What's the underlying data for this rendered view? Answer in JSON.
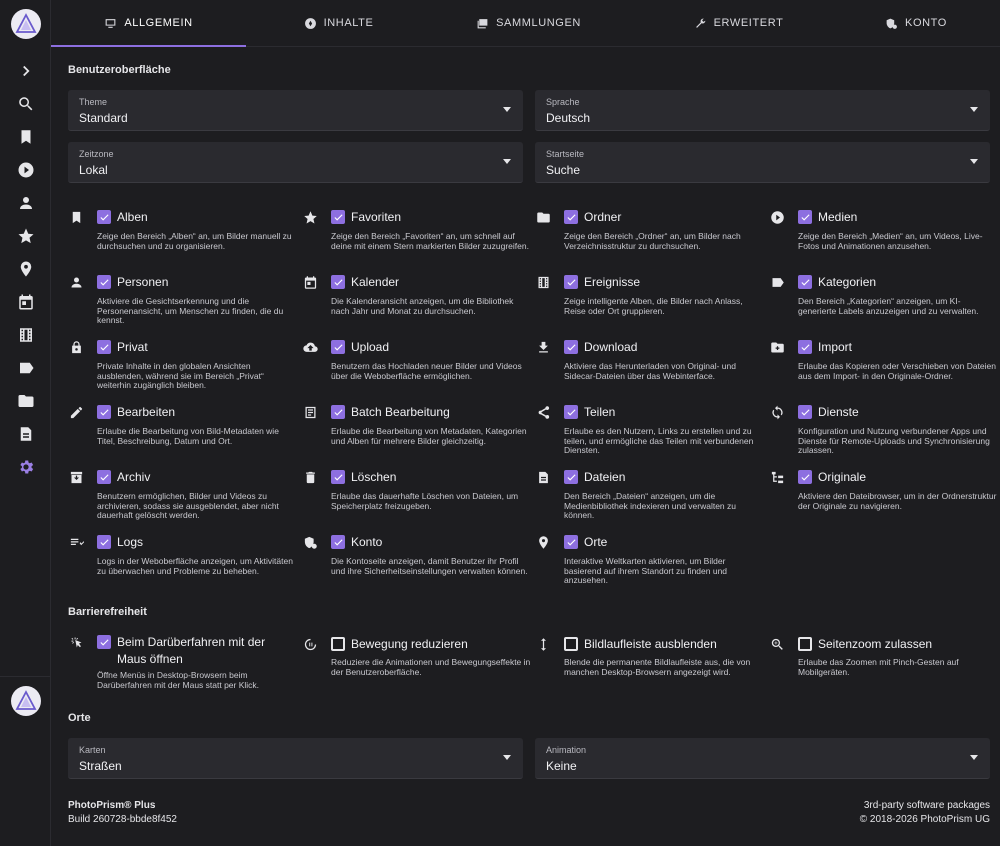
{
  "tabs": [
    {
      "label": "ALLGEMEIN",
      "icon": "monitor-icon",
      "active": true
    },
    {
      "label": "INHALTE",
      "icon": "aperture-icon"
    },
    {
      "label": "SAMMLUNGEN",
      "icon": "collections-icon"
    },
    {
      "label": "ERWEITERT",
      "icon": "wrench-icon"
    },
    {
      "label": "KONTO",
      "icon": "account-shield-icon"
    }
  ],
  "sections": {
    "ui": "Benutzeroberfläche",
    "accessibility": "Barrierefreiheit",
    "places": "Orte"
  },
  "selects": {
    "theme": {
      "label": "Theme",
      "value": "Standard"
    },
    "language": {
      "label": "Sprache",
      "value": "Deutsch"
    },
    "timezone": {
      "label": "Zeitzone",
      "value": "Lokal"
    },
    "startpage": {
      "label": "Startseite",
      "value": "Suche"
    },
    "maps": {
      "label": "Karten",
      "value": "Straßen"
    },
    "animation": {
      "label": "Animation",
      "value": "Keine"
    }
  },
  "options": [
    {
      "title": "Alben",
      "desc": "Zeige den Bereich „Alben“ an, um Bilder manuell zu durchsuchen und zu organisieren.",
      "checked": true,
      "icon": "bookmark-icon"
    },
    {
      "title": "Favoriten",
      "desc": "Zeige den Bereich „Favoriten“ an, um schnell auf deine mit einem Stern markierten Bilder zuzugreifen.",
      "checked": true,
      "icon": "star-icon"
    },
    {
      "title": "Ordner",
      "desc": "Zeige den Bereich „Ordner“ an, um Bilder nach Verzeichnisstruktur zu durchsuchen.",
      "checked": true,
      "icon": "folder-icon"
    },
    {
      "title": "Medien",
      "desc": "Zeige den Bereich „Medien“ an, um Videos, Live-Fotos und Animationen anzusehen.",
      "checked": true,
      "icon": "play-circle-icon"
    },
    {
      "title": "Personen",
      "desc": "Aktiviere die Gesichtserkennung und die Personenansicht, um Menschen zu finden, die du kennst.",
      "checked": true,
      "icon": "person-icon"
    },
    {
      "title": "Kalender",
      "desc": "Die Kalenderansicht anzeigen, um die Bibliothek nach Jahr und Monat zu durchsuchen.",
      "checked": true,
      "icon": "calendar-icon"
    },
    {
      "title": "Ereignisse",
      "desc": "Zeige intelligente Alben, die Bilder nach Anlass, Reise oder Ort gruppieren.",
      "checked": true,
      "icon": "film-icon"
    },
    {
      "title": "Kategorien",
      "desc": "Den Bereich „Kategorien“ anzeigen, um KI-generierte Labels anzuzeigen und zu verwalten.",
      "checked": true,
      "icon": "label-icon"
    },
    {
      "title": "Privat",
      "desc": "Private Inhalte in den globalen Ansichten ausblenden, während sie im Bereich „Privat“ weiterhin zugänglich bleiben.",
      "checked": true,
      "icon": "lock-icon"
    },
    {
      "title": "Upload",
      "desc": "Benutzern das Hochladen neuer Bilder und Videos über die Weboberfläche ermöglichen.",
      "checked": true,
      "icon": "cloud-upload-icon"
    },
    {
      "title": "Download",
      "desc": "Aktiviere das Herunterladen von Original- und Sidecar-Dateien über das Webinterface.",
      "checked": true,
      "icon": "download-icon"
    },
    {
      "title": "Import",
      "desc": "Erlaube das Kopieren oder Verschieben von Dateien aus dem Import- in den Originale-Ordner.",
      "checked": true,
      "icon": "folder-plus-icon"
    },
    {
      "title": "Bearbeiten",
      "desc": "Erlaube die Bearbeitung von Bild-Metadaten wie Titel, Beschreibung, Datum und Ort.",
      "checked": true,
      "icon": "pencil-icon"
    },
    {
      "title": "Batch Bearbeitung",
      "desc": "Erlaube die Bearbeitung von Metadaten, Kategorien und Alben für mehrere Bilder gleichzeitig.",
      "checked": true,
      "icon": "batch-list-icon"
    },
    {
      "title": "Teilen",
      "desc": "Erlaube es den Nutzern, Links zu erstellen und zu teilen, und ermögliche das Teilen mit verbundenen Diensten.",
      "checked": true,
      "icon": "share-icon"
    },
    {
      "title": "Dienste",
      "desc": "Konfiguration und Nutzung verbundener Apps und Dienste für Remote-Uploads und Synchronisierung zulassen.",
      "checked": true,
      "icon": "sync-icon"
    },
    {
      "title": "Archiv",
      "desc": "Benutzern ermöglichen, Bilder und Videos zu archivieren, sodass sie ausgeblendet, aber nicht dauerhaft gelöscht werden.",
      "checked": true,
      "icon": "archive-icon"
    },
    {
      "title": "Löschen",
      "desc": "Erlaube das dauerhafte Löschen von Dateien, um Speicherplatz freizugeben.",
      "checked": true,
      "icon": "trash-icon"
    },
    {
      "title": "Dateien",
      "desc": "Den Bereich „Dateien“ anzeigen, um die Medienbibliothek indexieren und verwalten zu können.",
      "checked": true,
      "icon": "file-cabinet-icon"
    },
    {
      "title": "Originale",
      "desc": "Aktiviere den Dateibrowser, um in der Ordnerstruktur der Originale zu navigieren.",
      "checked": true,
      "icon": "file-tree-icon"
    },
    {
      "title": "Logs",
      "desc": "Logs in der Weboberfläche anzeigen, um Aktivitäten zu überwachen und Probleme zu beheben.",
      "checked": true,
      "icon": "logs-icon"
    },
    {
      "title": "Konto",
      "desc": "Die Kontoseite anzeigen, damit Benutzer ihr Profil und ihre Sicherheitseinstellungen verwalten können.",
      "checked": true,
      "icon": "account-shield-icon"
    },
    {
      "title": "Orte",
      "desc": "Interaktive Weltkarten aktivieren, um Bilder basierend auf ihrem Standort zu finden und anzusehen.",
      "checked": true,
      "icon": "map-marker-icon"
    }
  ],
  "accessibility_options": [
    {
      "title": "Beim Darüberfahren mit der Maus öffnen",
      "desc": "Öffne Menüs in Desktop-Browsern beim Darüberfahren mit der Maus statt per Klick.",
      "checked": true,
      "icon": "cursor-click-icon"
    },
    {
      "title": "Bewegung reduzieren",
      "desc": "Reduziere die Animationen und Bewegungseffekte in der Benutzeroberfläche.",
      "checked": false,
      "icon": "motion-pause-icon"
    },
    {
      "title": "Bildlaufleiste ausblenden",
      "desc": "Blende die permanente Bildlaufleiste aus, die von manchen Desktop-Browsern angezeigt wird.",
      "checked": false,
      "icon": "vertical-arrows-icon"
    },
    {
      "title": "Seitenzoom zulassen",
      "desc": "Erlaube das Zoomen mit Pinch-Gesten auf Mobilgeräten.",
      "checked": false,
      "icon": "zoom-icon"
    }
  ],
  "footer": {
    "brand": "PhotoPrism® Plus",
    "build": "Build 260728-bbde8f452",
    "packages": "3rd-party software packages",
    "copyright": "© 2018-2026 PhotoPrism UG"
  },
  "colors": {
    "accent": "#8d6fe0",
    "background": "#1d1d20",
    "field": "#2a2a2f"
  }
}
